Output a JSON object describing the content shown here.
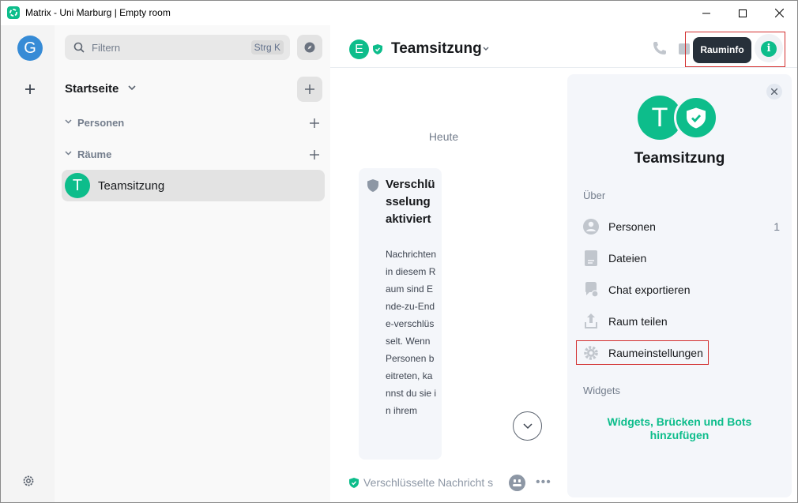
{
  "window": {
    "title": "Matrix - Uni Marburg | Empty room",
    "minimize_icon": "minimize-icon",
    "maximize_icon": "maximize-icon",
    "close_icon": "close-icon"
  },
  "rail": {
    "user_avatar_letter": "G",
    "user_avatar_color": "#368bd6"
  },
  "roomlist": {
    "filter_placeholder": "Filtern",
    "filter_shortcut": "Strg K",
    "home_title": "Startseite",
    "sections": [
      {
        "label": "Personen"
      },
      {
        "label": "Räume"
      }
    ],
    "rooms": [
      {
        "letter": "T",
        "name": "Teamsitzung"
      }
    ]
  },
  "room_header": {
    "avatar_letter": "E",
    "name": "Teamsitzung",
    "tooltip": "Rauminfo",
    "info_icon": "i"
  },
  "timeline": {
    "date_separator": "Heute",
    "e2e_title": "Verschlüsselung aktiviert",
    "e2e_body": "Nachrichten in diesem Raum sind Ende-zu-Ende-verschlüsselt. Wenn Personen beitreten, kannst du sie in ihrem"
  },
  "composer": {
    "placeholder": "Verschlüsselte Nachricht s"
  },
  "right_panel": {
    "avatar_letter": "T",
    "room_name": "Teamsitzung",
    "about_label": "Über",
    "items": [
      {
        "label": "Personen",
        "count": "1",
        "icon": "people-icon"
      },
      {
        "label": "Dateien",
        "count": "",
        "icon": "files-icon"
      },
      {
        "label": "Chat exportieren",
        "count": "",
        "icon": "export-icon"
      },
      {
        "label": "Raum teilen",
        "count": "",
        "icon": "share-icon"
      },
      {
        "label": "Raumeinstellungen",
        "count": "",
        "icon": "settings-icon"
      }
    ],
    "widgets_label": "Widgets",
    "widgets_link": "Widgets, Brücken und Bots hinzufügen"
  },
  "colors": {
    "accent": "#0dbd8b",
    "highlight": "#d32f2f",
    "tooltip_bg": "#27303a"
  }
}
